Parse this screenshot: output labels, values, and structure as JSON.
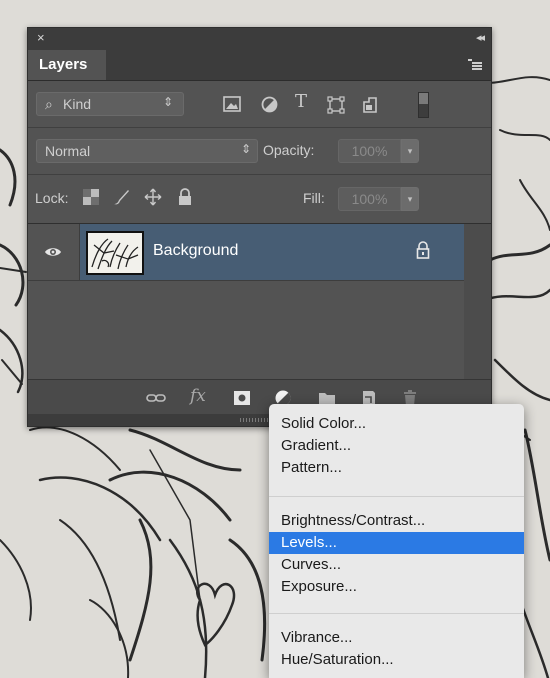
{
  "panel": {
    "close_glyph": "×",
    "collapse_glyph": "◂◂",
    "tab_label": "Layers",
    "filter": {
      "kind_label": "Kind"
    },
    "blend": {
      "mode": "Normal",
      "opacity_label": "Opacity:",
      "opacity_value": "100%"
    },
    "lock": {
      "label": "Lock:",
      "fill_label": "Fill:",
      "fill_value": "100%"
    },
    "layers": [
      {
        "name": "Background",
        "visible": true,
        "locked": true,
        "selected": true
      }
    ],
    "footer_icons": [
      "link-layers-icon",
      "fx-icon",
      "layer-mask-icon",
      "adjustment-layer-icon",
      "new-group-icon",
      "new-layer-icon",
      "trash-icon"
    ]
  },
  "menu": {
    "items": [
      {
        "label": "Solid Color..."
      },
      {
        "label": "Gradient..."
      },
      {
        "label": "Pattern..."
      },
      {
        "label": "Brightness/Contrast..."
      },
      {
        "label": "Levels...",
        "selected": true
      },
      {
        "label": "Curves..."
      },
      {
        "label": "Exposure..."
      },
      {
        "label": "Vibrance..."
      },
      {
        "label": "Hue/Saturation..."
      }
    ]
  },
  "colors": {
    "panel_bg": "#535353",
    "selected_layer": "#475d74",
    "menu_highlight": "#2b7ae4",
    "menu_bg": "#e9e9e9"
  }
}
